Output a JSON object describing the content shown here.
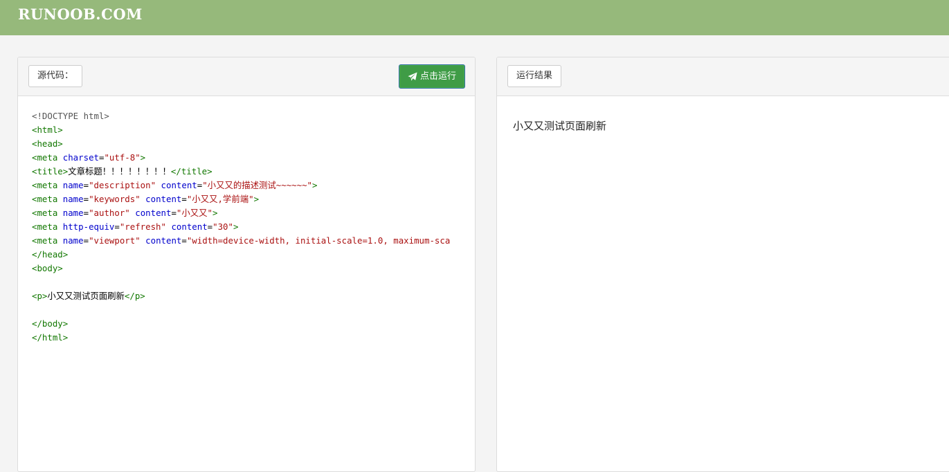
{
  "header": {
    "logo": "RUNOOB.COM"
  },
  "editor": {
    "label": "源代码：",
    "run_label": "点击运行",
    "lines": [
      [
        [
          "doctype",
          "<!DOCTYPE html>"
        ]
      ],
      [
        [
          "tag",
          "<html>"
        ]
      ],
      [
        [
          "tag",
          "<head>"
        ]
      ],
      [
        [
          "tag",
          "<meta "
        ],
        [
          "attr",
          "charset"
        ],
        [
          "txt",
          "="
        ],
        [
          "str",
          "\"utf-8\""
        ],
        [
          "tag",
          ">"
        ]
      ],
      [
        [
          "tag",
          "<title>"
        ],
        [
          "txt",
          "文章标题！！！！！！！！"
        ],
        [
          "tag",
          "</title>"
        ]
      ],
      [
        [
          "tag",
          "<meta "
        ],
        [
          "attr",
          "name"
        ],
        [
          "txt",
          "="
        ],
        [
          "str",
          "\"description\""
        ],
        [
          "txt",
          " "
        ],
        [
          "attr",
          "content"
        ],
        [
          "txt",
          "="
        ],
        [
          "str",
          "\"小又又的描述测试~~~~~~\""
        ],
        [
          "tag",
          ">"
        ]
      ],
      [
        [
          "tag",
          "<meta "
        ],
        [
          "attr",
          "name"
        ],
        [
          "txt",
          "="
        ],
        [
          "str",
          "\"keywords\""
        ],
        [
          "txt",
          " "
        ],
        [
          "attr",
          "content"
        ],
        [
          "txt",
          "="
        ],
        [
          "str",
          "\"小又又,学前端\""
        ],
        [
          "tag",
          ">"
        ]
      ],
      [
        [
          "tag",
          "<meta "
        ],
        [
          "attr",
          "name"
        ],
        [
          "txt",
          "="
        ],
        [
          "str",
          "\"author\""
        ],
        [
          "txt",
          " "
        ],
        [
          "attr",
          "content"
        ],
        [
          "txt",
          "="
        ],
        [
          "str",
          "\"小又又\""
        ],
        [
          "tag",
          ">"
        ]
      ],
      [
        [
          "tag",
          "<meta "
        ],
        [
          "attr",
          "http-equiv"
        ],
        [
          "txt",
          "="
        ],
        [
          "str",
          "\"refresh\""
        ],
        [
          "txt",
          " "
        ],
        [
          "attr",
          "content"
        ],
        [
          "txt",
          "="
        ],
        [
          "str",
          "\"30\""
        ],
        [
          "tag",
          ">"
        ]
      ],
      [
        [
          "tag",
          "<meta "
        ],
        [
          "attr",
          "name"
        ],
        [
          "txt",
          "="
        ],
        [
          "str",
          "\"viewport\""
        ],
        [
          "txt",
          " "
        ],
        [
          "attr",
          "content"
        ],
        [
          "txt",
          "="
        ],
        [
          "str",
          "\"width=device-width, initial-scale=1.0, maximum-sca"
        ]
      ],
      [
        [
          "tag",
          "</head>"
        ]
      ],
      [
        [
          "tag",
          "<body>"
        ]
      ],
      [],
      [
        [
          "tag",
          "<p>"
        ],
        [
          "txt",
          "小又又测试页面刷新"
        ],
        [
          "tag",
          "</p>"
        ]
      ],
      [],
      [
        [
          "tag",
          "</body>"
        ]
      ],
      [
        [
          "tag",
          "</html>"
        ]
      ]
    ]
  },
  "result": {
    "label": "运行结果",
    "content": "小又又测试页面刷新"
  }
}
